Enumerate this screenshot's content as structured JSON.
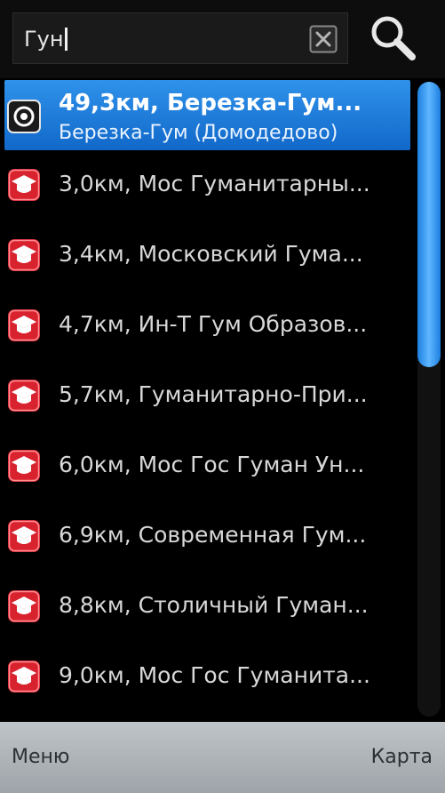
{
  "search": {
    "query": "Гун"
  },
  "results": [
    {
      "title": "49,3км, Березка-Гум...",
      "subtitle": "Березка-Гум (Домодедово)",
      "icon": "target-icon",
      "selected": true
    },
    {
      "title": "3,0км, Мос Гуманитарны...",
      "icon": "graduation-cap-icon"
    },
    {
      "title": "3,4км, Московский Гума...",
      "icon": "graduation-cap-icon"
    },
    {
      "title": "4,7км, Ин-Т Гум Образов...",
      "icon": "graduation-cap-icon"
    },
    {
      "title": "5,7км, Гуманитарно-При...",
      "icon": "graduation-cap-icon"
    },
    {
      "title": "6,0км, Мос Гос Гуман Ун...",
      "icon": "graduation-cap-icon"
    },
    {
      "title": "6,9км, Современная Гум...",
      "icon": "graduation-cap-icon"
    },
    {
      "title": "8,8км, Столичный Гуман...",
      "icon": "graduation-cap-icon"
    },
    {
      "title": "9,0км, Мос Гос Гуманита...",
      "icon": "graduation-cap-icon"
    }
  ],
  "scroll": {
    "position_fraction": 0.0,
    "visible_fraction": 0.45
  },
  "softkeys": {
    "left": "Меню",
    "right": "Карта"
  },
  "colors": {
    "selection": "#2b8ae6",
    "category_icon": "#d8232f",
    "softkey_bar": "#aeb3b8"
  }
}
